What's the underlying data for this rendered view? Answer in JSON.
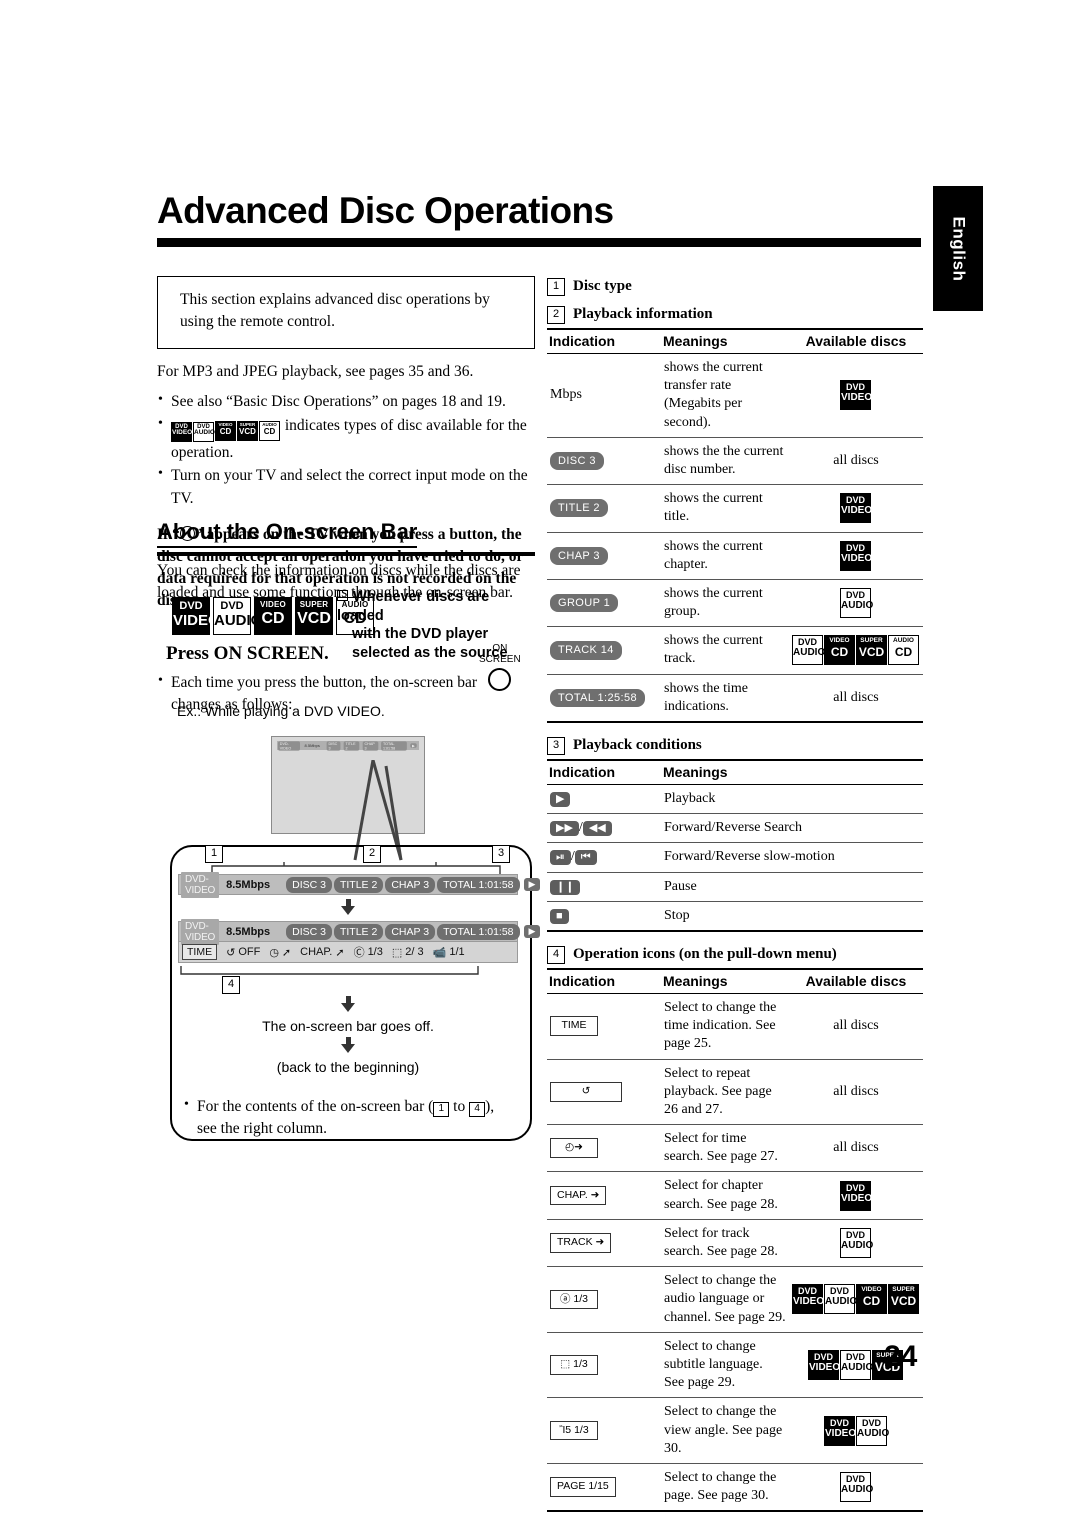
{
  "side_tab": {
    "label": "English"
  },
  "page_title": "Advanced Disc Operations",
  "page_number": "24",
  "left": {
    "intro_box": "This section explains advanced disc operations by using the remote control.",
    "mp3_line": "For MP3 and JPEG playback, see pages 35 and 36.",
    "bullet_1": "See also “Basic Disc Operations” on pages 18 and 19.",
    "bullet_2_after_icons": "indicates types of disc available for the operation.",
    "bullet_3": "Turn on your TV and select the correct input mode on the TV.",
    "warning": "appears on the TV when you press a button, the disc cannot accept an operation you have tried to do, or data required for that operation is not recorded on the disc.",
    "warning_prefix": "If “",
    "warning_quote_close": "”",
    "section_heading": "About the On-screen Bar",
    "section_body": "You can check the information on discs while the discs are loaded and use some functions through the on-screen bar.",
    "whenever_line1": "Whenever discs are loaded",
    "whenever_line2": "with the DVD player",
    "whenever_line3": "selected as the source",
    "press_on_screen": "Press ON SCREEN.",
    "press_bullet": "Each time you press the button, the on-screen bar changes as follows:",
    "onscreen_button_line1": "ON",
    "onscreen_button_line2": "SCREEN",
    "example_line": "Ex.: While playing a DVD VIDEO.",
    "flow": {
      "num_1": "1",
      "num_2": "2",
      "num_3": "3",
      "num_4": "4",
      "bar_goes_off": "The on-screen bar goes off.",
      "back_to_beginning": "(back to the beginning)",
      "final_bullet_a": "For the contents of the on-screen bar (",
      "final_bullet_to": " to ",
      "final_bullet_b": "), see the right column."
    },
    "osd_bar": {
      "disc_type": "DVD-VIDEO",
      "bitrate": "8.5Mbps",
      "disc": "DISC 3",
      "title": "TITLE 2",
      "chapter": "CHAP 3",
      "total": "TOTAL  1:01:58",
      "play_icon": "▶"
    },
    "osd_menu": {
      "time": "TIME",
      "repeat": "OFF",
      "time_search": "",
      "chapter_search": "CHAP.",
      "audio": "1/3",
      "subtitle": "2/ 3",
      "angle": "1/1"
    },
    "disc_badges": [
      {
        "top": "DVD",
        "bottom": "VIDEO",
        "style": "dark"
      },
      {
        "top": "DVD",
        "bottom": "AUDIO",
        "style": "light"
      },
      {
        "top": "VIDEO",
        "bottom": "CD",
        "style": "dark",
        "small_top": true
      },
      {
        "top": "SUPER",
        "bottom": "VCD",
        "style": "dark",
        "small_top": true
      },
      {
        "top": "AUDIO",
        "bottom": "CD",
        "style": "light",
        "small_top": true
      }
    ]
  },
  "right": {
    "item1": {
      "num": "1",
      "label": "Disc type"
    },
    "item2": {
      "num": "2",
      "label": "Playback information",
      "headers": [
        "Indication",
        "Meanings",
        "Available discs"
      ],
      "rows": [
        {
          "indication": "Mbps",
          "ind_style": "plain",
          "meaning": "shows the current transfer rate (Megabits per second).",
          "discs": [
            {
              "top": "DVD",
              "bottom": "VIDEO",
              "style": "dark"
            }
          ],
          "discs_text": ""
        },
        {
          "indication": "DISC 3",
          "ind_style": "pill",
          "meaning": "shows the the current disc number.",
          "discs": [],
          "discs_text": "all discs"
        },
        {
          "indication": "TITLE 2",
          "ind_style": "pill",
          "meaning": "shows the current title.",
          "discs": [
            {
              "top": "DVD",
              "bottom": "VIDEO",
              "style": "dark"
            }
          ],
          "discs_text": ""
        },
        {
          "indication": "CHAP 3",
          "ind_style": "pill",
          "meaning": "shows the current chapter.",
          "discs": [
            {
              "top": "DVD",
              "bottom": "VIDEO",
              "style": "dark"
            }
          ],
          "discs_text": ""
        },
        {
          "indication": "GROUP 1",
          "ind_style": "pill",
          "meaning": "shows the current group.",
          "discs": [
            {
              "top": "DVD",
              "bottom": "AUDIO",
              "style": "light"
            }
          ],
          "discs_text": ""
        },
        {
          "indication": "TRACK 14",
          "ind_style": "pill",
          "meaning": "shows the current track.",
          "discs": [
            {
              "top": "DVD",
              "bottom": "AUDIO",
              "style": "light"
            },
            {
              "top": "VIDEO",
              "bottom": "CD",
              "style": "dark",
              "small_top": true
            },
            {
              "top": "SUPER",
              "bottom": "VCD",
              "style": "dark",
              "small_top": true
            },
            {
              "top": "AUDIO",
              "bottom": "CD",
              "style": "light",
              "small_top": true
            }
          ],
          "discs_text": ""
        },
        {
          "indication": "TOTAL 1:25:58",
          "ind_style": "pill",
          "meaning": "shows the time indications.",
          "discs": [],
          "discs_text": "all discs"
        }
      ]
    },
    "item3": {
      "num": "3",
      "label": "Playback conditions",
      "headers": [
        "Indication",
        "Meanings"
      ],
      "rows": [
        {
          "icon": "▶",
          "icon2": "",
          "meaning": "Playback"
        },
        {
          "icon": "▶▶",
          "icon2": "◀◀",
          "meaning": "Forward/Reverse Search"
        },
        {
          "icon": "⏯",
          "icon2": "⏮",
          "meaning": "Forward/Reverse slow-motion"
        },
        {
          "icon": "❙❙",
          "icon2": "",
          "meaning": "Pause"
        },
        {
          "icon": "■",
          "icon2": "",
          "meaning": "Stop"
        }
      ]
    },
    "item4": {
      "num": "4",
      "label": "Operation icons (on the pull-down menu)",
      "headers": [
        "Indication",
        "Meanings",
        "Available discs"
      ],
      "rows": [
        {
          "indication": "TIME",
          "ind_kind": "box",
          "meaning": "Select to change the time indication. See page 25.",
          "discs": [],
          "discs_text": "all discs"
        },
        {
          "indication": "↺",
          "ind_kind": "box-wide",
          "meaning": "Select to repeat playback. See page 26 and 27.",
          "discs": [],
          "discs_text": "all discs"
        },
        {
          "indication": "◴➜",
          "ind_kind": "box",
          "meaning": "Select for time search. See page 27.",
          "discs": [],
          "discs_text": "all discs"
        },
        {
          "indication": "CHAP. ➜",
          "ind_kind": "box",
          "meaning": "Select for chapter search. See page 28.",
          "discs": [
            {
              "top": "DVD",
              "bottom": "VIDEO",
              "style": "dark"
            }
          ],
          "discs_text": ""
        },
        {
          "indication": "TRACK ➜",
          "ind_kind": "box",
          "meaning": "Select for track search. See page 28.",
          "discs": [
            {
              "top": "DVD",
              "bottom": "AUDIO",
              "style": "light"
            }
          ],
          "discs_text": ""
        },
        {
          "indication": "ⓐ 1/3",
          "ind_kind": "box",
          "meaning": "Select to change the audio language or channel. See page 29.",
          "discs": [
            {
              "top": "DVD",
              "bottom": "VIDEO",
              "style": "dark"
            },
            {
              "top": "DVD",
              "bottom": "AUDIO",
              "style": "light"
            },
            {
              "top": "VIDEO",
              "bottom": "CD",
              "style": "dark",
              "small_top": true
            },
            {
              "top": "SUPER",
              "bottom": "VCD",
              "style": "dark",
              "small_top": true
            }
          ],
          "discs_text": ""
        },
        {
          "indication": "⬚ 1/3",
          "ind_kind": "box",
          "meaning": "Select to change subtitle language. See page 29.",
          "discs": [
            {
              "top": "DVD",
              "bottom": "VIDEO",
              "style": "dark"
            },
            {
              "top": "DVD",
              "bottom": "AUDIO",
              "style": "light"
            },
            {
              "top": "SUPER",
              "bottom": "VCD",
              "style": "dark",
              "small_top": true
            }
          ],
          "discs_text": ""
        },
        {
          "indication": "Ἲ5 1/3",
          "ind_kind": "box",
          "meaning": "Select to change the view angle. See page 30.",
          "discs": [
            {
              "top": "DVD",
              "bottom": "VIDEO",
              "style": "dark"
            },
            {
              "top": "DVD",
              "bottom": "AUDIO",
              "style": "light"
            }
          ],
          "discs_text": ""
        },
        {
          "indication": "PAGE 1/15",
          "ind_kind": "box",
          "meaning": "Select to change the page. See page 30.",
          "discs": [
            {
              "top": "DVD",
              "bottom": "AUDIO",
              "style": "light"
            }
          ],
          "discs_text": ""
        }
      ]
    }
  }
}
